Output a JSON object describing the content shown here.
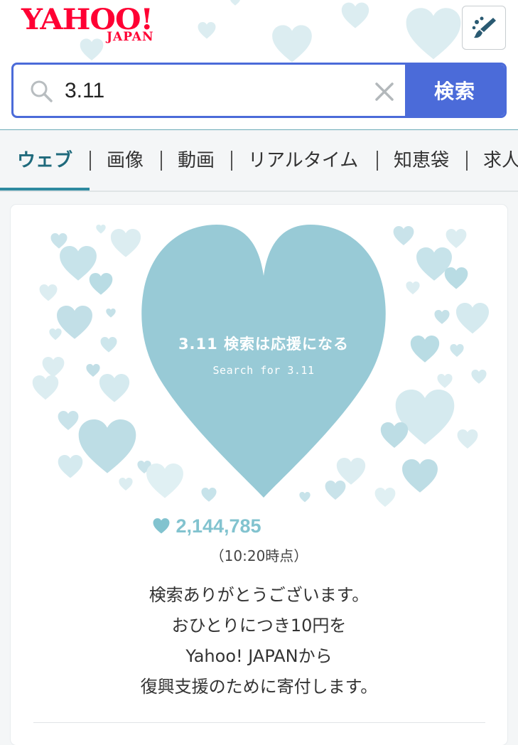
{
  "header": {
    "logo_main": "YAHOO!",
    "logo_sub": "JAPAN",
    "theme_button_icon": "paintbrush-icon"
  },
  "search": {
    "query": "3.11",
    "button_label": "検索",
    "accent_color": "#4b6bd9"
  },
  "tabs": [
    {
      "label": "ウェブ",
      "active": true
    },
    {
      "label": "画像",
      "active": false
    },
    {
      "label": "動画",
      "active": false
    },
    {
      "label": "リアルタイム",
      "active": false
    },
    {
      "label": "知恵袋",
      "active": false
    },
    {
      "label": "求人",
      "active": false
    }
  ],
  "campaign": {
    "title": "3.11 検索は応援になる",
    "subtitle": "Search for 3.11",
    "heart_color": "#98cad6",
    "count": "2,144,785",
    "time": "（10:20時点）",
    "message_lines": [
      "検索ありがとうございます。",
      "おひとりにつき10円を",
      "Yahoo! JAPANから",
      "復興支援のために寄付します。"
    ]
  }
}
